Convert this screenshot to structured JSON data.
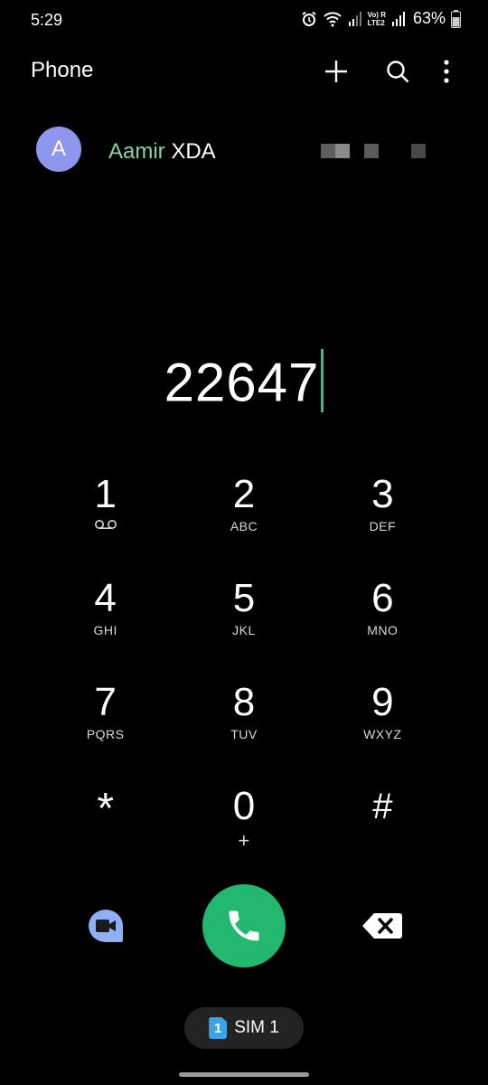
{
  "status_bar": {
    "time": "5:29",
    "network_label_top": "Vo) R",
    "network_label_bottom": "LTE2",
    "battery_percent": "63%",
    "icons": [
      "alarm-icon",
      "wifi-icon",
      "signal-icon",
      "signal-icon-2",
      "battery-icon"
    ]
  },
  "app_bar": {
    "title": "Phone",
    "actions": [
      "add-icon",
      "search-icon",
      "more-options-icon"
    ]
  },
  "suggestion": {
    "avatar_initial": "A",
    "name_match": "Aamir",
    "name_rest": " XDA",
    "number_redacted": true
  },
  "dialer": {
    "number": "22647"
  },
  "keypad": {
    "keys": [
      {
        "digit": "1",
        "sub": "",
        "sub_icon": "voicemail-icon"
      },
      {
        "digit": "2",
        "sub": "ABC"
      },
      {
        "digit": "3",
        "sub": "DEF"
      },
      {
        "digit": "4",
        "sub": "GHI"
      },
      {
        "digit": "5",
        "sub": "JKL"
      },
      {
        "digit": "6",
        "sub": "MNO"
      },
      {
        "digit": "7",
        "sub": "PQRS"
      },
      {
        "digit": "8",
        "sub": "TUV"
      },
      {
        "digit": "9",
        "sub": "WXYZ"
      },
      {
        "digit": "*",
        "sub": ""
      },
      {
        "digit": "0",
        "sub": "+"
      },
      {
        "digit": "#",
        "sub": ""
      }
    ]
  },
  "actions": {
    "video_call_icon": "video-call-icon",
    "call_icon": "phone-call-icon",
    "backspace_icon": "backspace-icon",
    "call_color": "#23b86f",
    "video_color": "#8fb0f4"
  },
  "sim": {
    "badge": "1",
    "label": "SIM 1"
  }
}
